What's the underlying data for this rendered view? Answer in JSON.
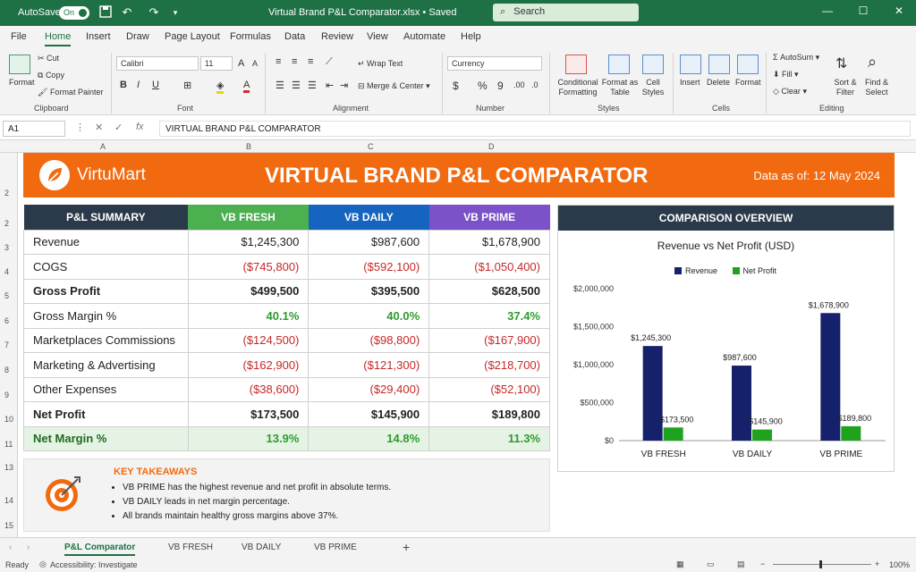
{
  "titlebar": {
    "autosave_label": "AutoSave",
    "autosave_state": "On",
    "document_title": "Virtual Brand P&L Comparator.xlsx  •  Saved",
    "search_placeholder": "Search"
  },
  "menu": [
    "File",
    "Home",
    "Insert",
    "Draw",
    "Page Layout",
    "Formulas",
    "Data",
    "Review",
    "View",
    "Automate",
    "Help"
  ],
  "ribbon": {
    "clipboard": {
      "paste": "Format",
      "cut": "Cut",
      "copy": "Copy",
      "format_painter": "Format Painter",
      "label": "Clipboard"
    },
    "font": {
      "name": "Calibri",
      "size": "11",
      "label": "Font"
    },
    "alignment": {
      "wrap": "Wrap Text",
      "merge": "Merge & Center",
      "label": "Alignment"
    },
    "number": {
      "format": "Currency",
      "label": "Number"
    },
    "styles": {
      "conditional": "Conditional Formatting",
      "format_table": "Format as Table",
      "cell_styles": "Cell Styles",
      "label": "Styles"
    },
    "cells": {
      "insert": "Insert",
      "delete": "Delete",
      "format": "Format",
      "label": "Cells"
    },
    "editing": {
      "autosum": "AutoSum",
      "fill": "Fill",
      "clear": "Clear",
      "sort": "Sort & Filter",
      "find": "Find & Select",
      "label": "Editing"
    }
  },
  "formula_bar": {
    "cell_ref": "A1",
    "fx": "fx",
    "content": "VIRTUAL BRAND P&L COMPARATOR"
  },
  "columns": [
    "A",
    "B",
    "C",
    "D"
  ],
  "rows": [
    "2",
    "2",
    "3",
    "4",
    "5",
    "6",
    "7",
    "8",
    "9",
    "10",
    "11",
    "13",
    "14",
    "15"
  ],
  "banner": {
    "logo_name": "VirtuMart",
    "title": "VIRTUAL BRAND P&L COMPARATOR",
    "date": "Data as of: 12 May 2024",
    "accent": "#f26a0f"
  },
  "pl": {
    "header": [
      "P&L SUMMARY",
      "VB FRESH",
      "VB DAILY",
      "VB PRIME"
    ],
    "header_colors": [
      "#2b3a4a",
      "#4caf50",
      "#1565c0",
      "#7b52c7"
    ],
    "rows": [
      {
        "label": "Revenue",
        "values": [
          "$1,245,300",
          "$987,600",
          "$1,678,900"
        ],
        "style": "plain"
      },
      {
        "label": "COGS",
        "values": [
          "($745,800)",
          "($592,100)",
          "($1,050,400)"
        ],
        "style": "neg"
      },
      {
        "label": "Gross Profit",
        "values": [
          "$499,500",
          "$395,500",
          "$628,500"
        ],
        "style": "bold"
      },
      {
        "label": "Gross Margin %",
        "values": [
          "40.1%",
          "40.0%",
          "37.4%"
        ],
        "style": "pos"
      },
      {
        "label": "Marketplaces Commissions",
        "values": [
          "($124,500)",
          "($98,800)",
          "($167,900)"
        ],
        "style": "neg"
      },
      {
        "label": "Marketing & Advertising",
        "values": [
          "($162,900)",
          "($121,300)",
          "($218,700)"
        ],
        "style": "neg"
      },
      {
        "label": "Other Expenses",
        "values": [
          "($38,600)",
          "($29,400)",
          "($52,100)"
        ],
        "style": "neg"
      },
      {
        "label": "Net Profit",
        "values": [
          "$173,500",
          "$145,900",
          "$189,800"
        ],
        "style": "boldlabel"
      },
      {
        "label": "Net Margin %",
        "values": [
          "13.9%",
          "14.8%",
          "11.3%"
        ],
        "style": "margin"
      }
    ]
  },
  "takeaways": {
    "title": "KEY TAKEAWAYS",
    "items": [
      "VB PRIME has the highest revenue and net profit in absolute terms.",
      "VB DAILY leads in net margin percentage.",
      "All brands maintain healthy gross margins above 37%."
    ]
  },
  "comparison": {
    "header": "COMPARISON OVERVIEW"
  },
  "chart_data": {
    "type": "bar",
    "title": "Revenue vs Net Profit (USD)",
    "categories": [
      "VB FRESH",
      "VB DAILY",
      "VB PRIME"
    ],
    "series": [
      {
        "name": "Revenue",
        "values": [
          1245300,
          987600,
          1678900
        ],
        "labels": [
          "$1,245,300",
          "$987,600",
          "$1,678,900"
        ],
        "color": "#16216b"
      },
      {
        "name": "Net Profit",
        "values": [
          173500,
          145900,
          189800
        ],
        "labels": [
          "$173,500",
          "$145,900",
          "$189,800"
        ],
        "color": "#1fa31f"
      }
    ],
    "yticks": [
      "$0",
      "$500,000",
      "$1,000,000",
      "$1,500,000",
      "$2,000,000"
    ],
    "ylim": [
      0,
      2000000
    ],
    "legend": "top-center",
    "grid": false
  },
  "sheets": [
    "P&L Comparator",
    "VB FRESH",
    "VB DAILY",
    "VB PRIME"
  ],
  "status": {
    "ready": "Ready",
    "accessibility": "Accessibility: Investigate",
    "zoom": "100%"
  }
}
